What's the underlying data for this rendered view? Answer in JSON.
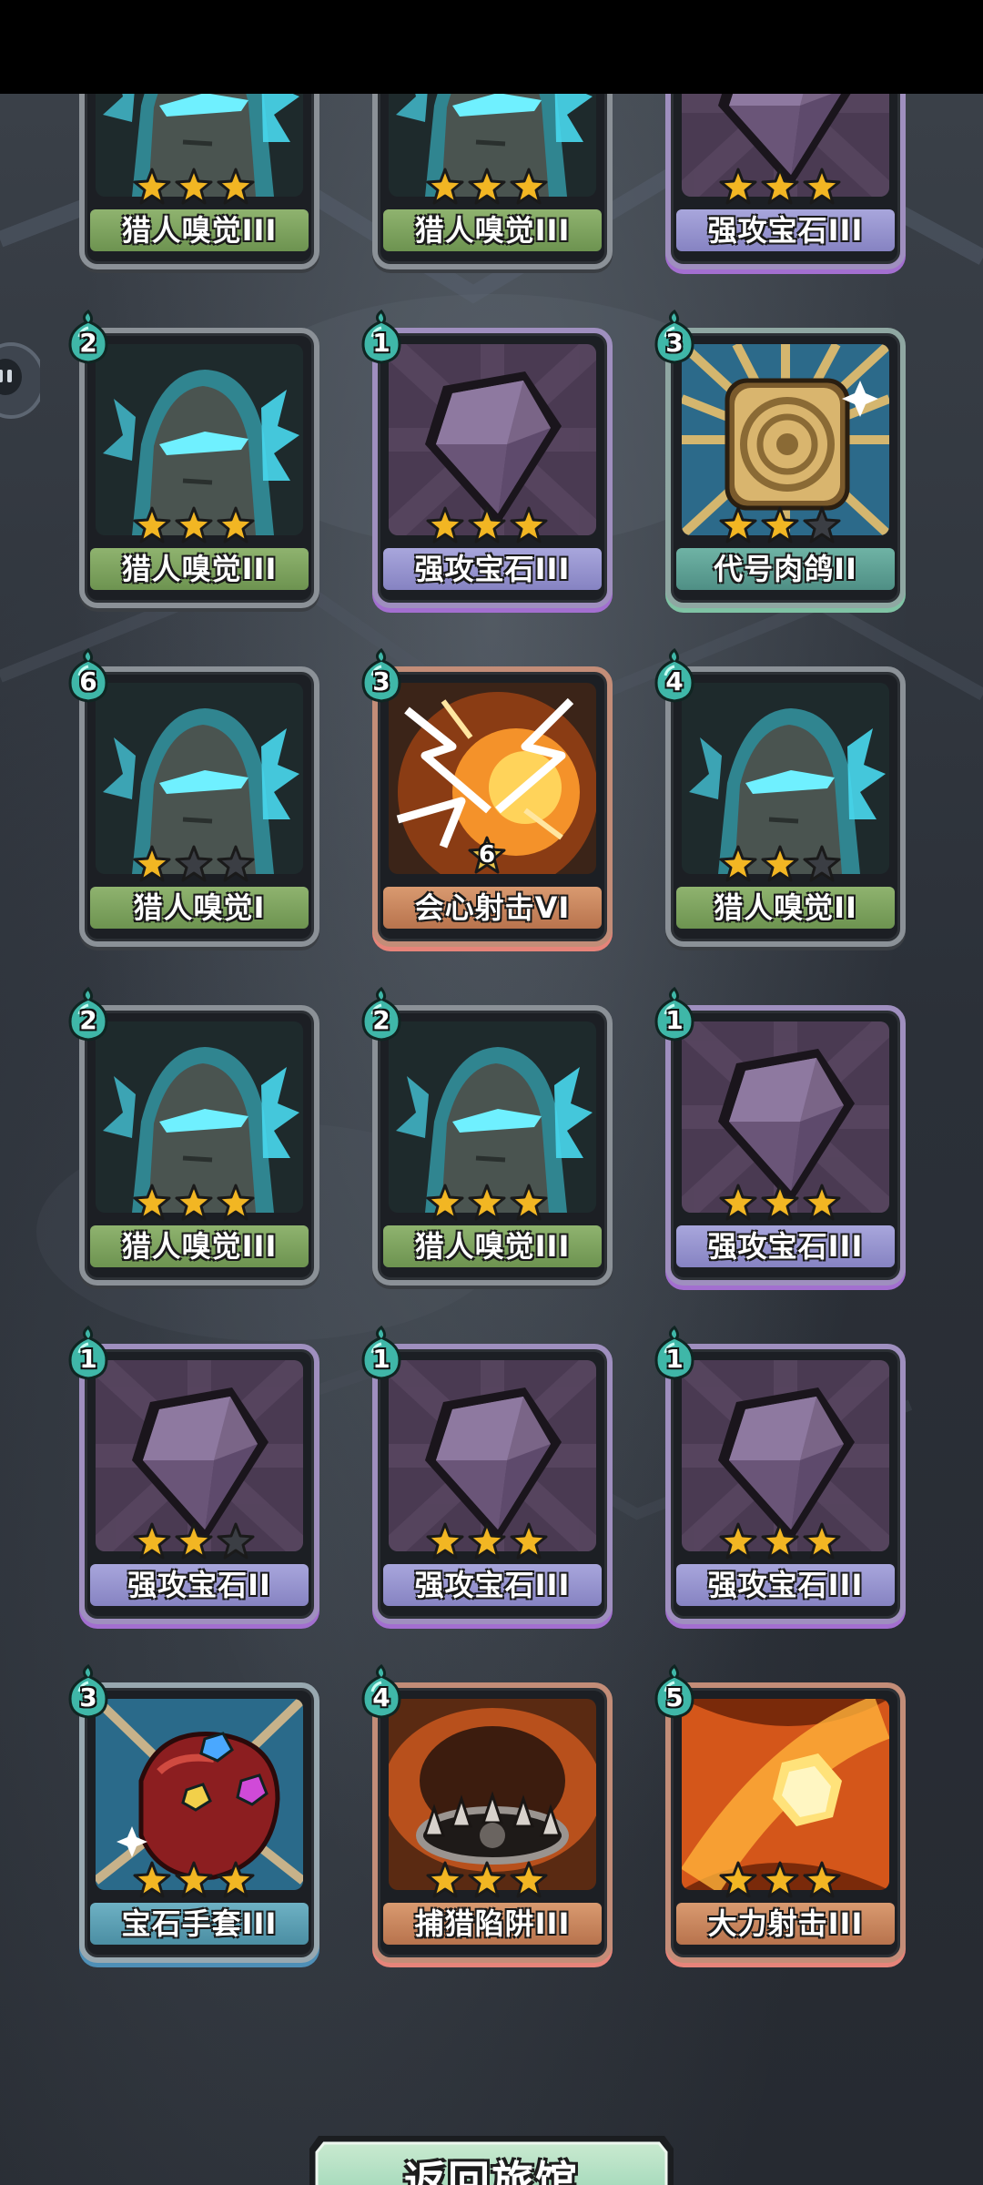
{
  "footer": {
    "return_label": "返回旅馆"
  },
  "colors": {
    "star_filled": "#f2b623",
    "star_empty": "#3b3e44",
    "cost_drop": "#3fb7a8",
    "bar_hunt": "#7ea15f",
    "bar_gem": "#9996d1"
  },
  "cards": [
    {
      "name": "猎人嗅觉III",
      "cost": "",
      "stars": 3,
      "art": "hunter-sense",
      "bar": "green",
      "frame": "t-hunt"
    },
    {
      "name": "猎人嗅觉III",
      "cost": "",
      "stars": 3,
      "art": "hunter-sense",
      "bar": "green",
      "frame": "t-hunt"
    },
    {
      "name": "强攻宝石III",
      "cost": "",
      "stars": 3,
      "art": "gem",
      "bar": "purple",
      "frame": "t-gem"
    },
    {
      "name": "猎人嗅觉III",
      "cost": "2",
      "stars": 3,
      "art": "hunter-sense",
      "bar": "green",
      "frame": "t-hunt"
    },
    {
      "name": "强攻宝石III",
      "cost": "1",
      "stars": 3,
      "art": "gem",
      "bar": "purple",
      "frame": "t-gem"
    },
    {
      "name": "代号肉鸽II",
      "cost": "3",
      "stars": 2,
      "art": "device",
      "bar": "teal",
      "frame": "t-gold"
    },
    {
      "name": "猎人嗅觉I",
      "cost": "6",
      "stars": 1,
      "art": "hunter-sense",
      "bar": "green",
      "frame": "t-hunt"
    },
    {
      "name": "会心射击VI",
      "cost": "3",
      "stars": 0,
      "level": "6",
      "art": "lightning",
      "bar": "orange",
      "frame": "t-fire"
    },
    {
      "name": "猎人嗅觉II",
      "cost": "4",
      "stars": 2,
      "art": "hunter-sense",
      "bar": "green",
      "frame": "t-hunt"
    },
    {
      "name": "猎人嗅觉III",
      "cost": "2",
      "stars": 3,
      "art": "hunter-sense",
      "bar": "green",
      "frame": "t-hunt"
    },
    {
      "name": "猎人嗅觉III",
      "cost": "2",
      "stars": 3,
      "art": "hunter-sense",
      "bar": "green",
      "frame": "t-hunt"
    },
    {
      "name": "强攻宝石III",
      "cost": "1",
      "stars": 3,
      "art": "gem",
      "bar": "purple",
      "frame": "t-gem"
    },
    {
      "name": "强攻宝石II",
      "cost": "1",
      "stars": 2,
      "art": "gem",
      "bar": "purple",
      "frame": "t-gem"
    },
    {
      "name": "强攻宝石III",
      "cost": "1",
      "stars": 3,
      "art": "gem",
      "bar": "purple",
      "frame": "t-gem"
    },
    {
      "name": "强攻宝石III",
      "cost": "1",
      "stars": 3,
      "art": "gem",
      "bar": "purple",
      "frame": "t-gem"
    },
    {
      "name": "宝石手套III",
      "cost": "3",
      "stars": 3,
      "art": "gauntlet",
      "bar": "sky",
      "frame": "t-blue"
    },
    {
      "name": "捕猎陷阱III",
      "cost": "4",
      "stars": 3,
      "art": "trap",
      "bar": "orange",
      "frame": "t-fire"
    },
    {
      "name": "大力射击III",
      "cost": "5",
      "stars": 3,
      "art": "power-shot",
      "bar": "orange",
      "frame": "t-fire"
    }
  ]
}
